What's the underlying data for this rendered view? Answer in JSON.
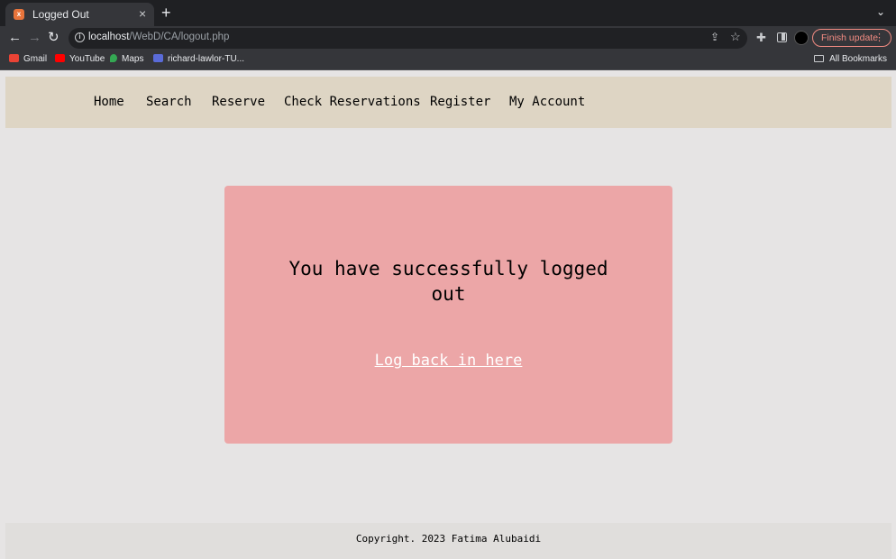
{
  "browser": {
    "tab": {
      "title": "Logged Out",
      "favicon": "xampp-icon",
      "close": "×"
    },
    "new_tab": "+",
    "tab_menu": "⌄",
    "nav": {
      "back": "←",
      "forward": "→",
      "reload": "↻"
    },
    "url": {
      "host": "localhost",
      "path": "/WebD/CA/logout.php"
    },
    "update_button": "Finish update",
    "update_menu": "⋮",
    "bookmarks": [
      {
        "label": "Gmail",
        "icon": "gmail-icon",
        "color": "#ea4335"
      },
      {
        "label": "YouTube",
        "icon": "youtube-icon",
        "color": "#ff0000"
      },
      {
        "label": "Maps",
        "icon": "maps-icon",
        "color": "#34a853"
      },
      {
        "label": "richard-lawlor-TU...",
        "icon": "trello-icon",
        "color": "#5a6bd8"
      }
    ],
    "all_bookmarks": "All Bookmarks"
  },
  "site": {
    "nav": [
      "Home",
      "Search",
      "Reserve",
      "Check Reservations",
      "Register",
      "My Account"
    ],
    "message": "You have successfully logged out",
    "link": "Log back in here",
    "footer": "Copyright. 2023 Fatima Alubaidi",
    "colors": {
      "nav_bg": "#ded5c4",
      "card_bg": "#eca6a7",
      "page_bg": "#e6e4e4"
    }
  }
}
